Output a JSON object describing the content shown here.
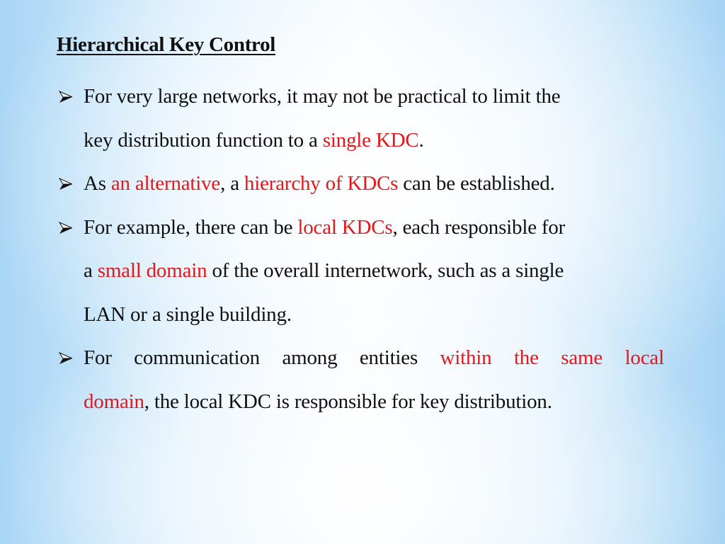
{
  "slide": {
    "title": "Hierarchical Key Control",
    "bullets": [
      {
        "lines": [
          [
            {
              "t": "For very large networks, it may not be practical to limit the",
              "hl": false
            }
          ],
          [
            {
              "t": "key distribution function to a ",
              "hl": false
            },
            {
              "t": "single KDC",
              "hl": true
            },
            {
              "t": ".",
              "hl": false
            }
          ]
        ]
      },
      {
        "lines": [
          [
            {
              "t": "As ",
              "hl": false
            },
            {
              "t": "an alternative",
              "hl": true
            },
            {
              "t": ", a ",
              "hl": false
            },
            {
              "t": "hierarchy of KDCs",
              "hl": true
            },
            {
              "t": " can be established.",
              "hl": false
            }
          ]
        ]
      },
      {
        "lines": [
          [
            {
              "t": "For example, there can be ",
              "hl": false
            },
            {
              "t": "local KDCs",
              "hl": true
            },
            {
              "t": ", each responsible for",
              "hl": false
            }
          ],
          [
            {
              "t": "a ",
              "hl": false
            },
            {
              "t": "small domain",
              "hl": true
            },
            {
              "t": " of the overall internetwork, such as a single",
              "hl": false
            }
          ],
          [
            {
              "t": "LAN or a single building.",
              "hl": false
            }
          ]
        ]
      },
      {
        "lines": [
          [
            {
              "t": "For communication among entities ",
              "hl": false
            },
            {
              "t": "within the same local",
              "hl": true
            }
          ],
          [
            {
              "t": "domain",
              "hl": true
            },
            {
              "t": ", the local KDC is responsible for key distribution.",
              "hl": false
            }
          ]
        ]
      }
    ],
    "bullet_icon": "arrowhead-bullet-icon",
    "highlight_color": "#e8161b",
    "text_color": "#111111"
  }
}
